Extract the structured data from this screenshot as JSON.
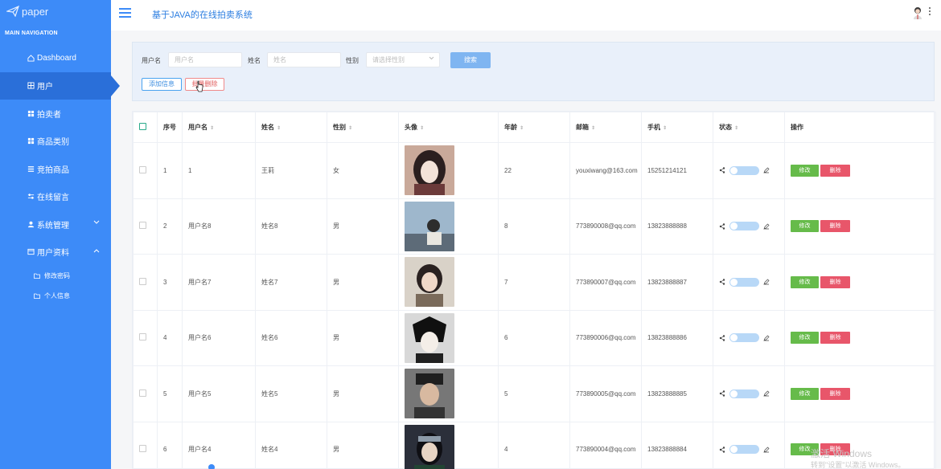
{
  "app": {
    "logo_text": "paper",
    "title": "基于JAVA的在线拍卖系统"
  },
  "sidebar": {
    "heading": "MAIN NAVIGATION",
    "items": [
      {
        "label": "Dashboard",
        "icon": "home-icon"
      },
      {
        "label": "用户",
        "icon": "grid-icon"
      },
      {
        "label": "拍卖者",
        "icon": "grid-icon"
      },
      {
        "label": "商品类别",
        "icon": "grid-icon"
      },
      {
        "label": "竞拍商品",
        "icon": "list-icon"
      },
      {
        "label": "在线留言",
        "icon": "sliders-icon"
      },
      {
        "label": "系统管理",
        "icon": "user-icon"
      },
      {
        "label": "用户资料",
        "icon": "window-icon"
      }
    ],
    "sub_items": [
      {
        "label": "修改密码",
        "icon": "folder-icon"
      },
      {
        "label": "个人信息",
        "icon": "folder-icon"
      }
    ]
  },
  "search": {
    "username_label": "用户名",
    "username_placeholder": "用户名",
    "name_label": "姓名",
    "name_placeholder": "姓名",
    "gender_label": "性别",
    "gender_placeholder": "请选择性别",
    "search_button": "搜索",
    "add_button": "添加信息",
    "batch_delete_button": "批量删除"
  },
  "table": {
    "headers": [
      "序号",
      "用户名",
      "姓名",
      "性别",
      "头像",
      "年龄",
      "邮箱",
      "手机",
      "状态",
      "操作"
    ],
    "edit_label": "修改",
    "delete_label": "删除",
    "rows": [
      {
        "no": "1",
        "username": "1",
        "name": "王莉",
        "gender": "女",
        "age": "22",
        "email": "youxiwang@163.com",
        "phone": "15251214121"
      },
      {
        "no": "2",
        "username": "用户名8",
        "name": "姓名8",
        "gender": "男",
        "age": "8",
        "email": "773890008@qq.com",
        "phone": "13823888888"
      },
      {
        "no": "3",
        "username": "用户名7",
        "name": "姓名7",
        "gender": "男",
        "age": "7",
        "email": "773890007@qq.com",
        "phone": "13823888887"
      },
      {
        "no": "4",
        "username": "用户名6",
        "name": "姓名6",
        "gender": "男",
        "age": "6",
        "email": "773890006@qq.com",
        "phone": "13823888886"
      },
      {
        "no": "5",
        "username": "用户名5",
        "name": "姓名5",
        "gender": "男",
        "age": "5",
        "email": "773890005@qq.com",
        "phone": "13823888885"
      },
      {
        "no": "6",
        "username": "用户名4",
        "name": "姓名4",
        "gender": "男",
        "age": "4",
        "email": "773890004@qq.com",
        "phone": "13823888884"
      }
    ]
  },
  "watermark": {
    "line1": "激活 Windows",
    "line2": "转到\"设置\"以激活 Windows。"
  },
  "colors": {
    "sidebar": "#3d8bf8",
    "active": "#2a6fd9",
    "edit": "#66bb4a",
    "delete": "#e8566a"
  }
}
